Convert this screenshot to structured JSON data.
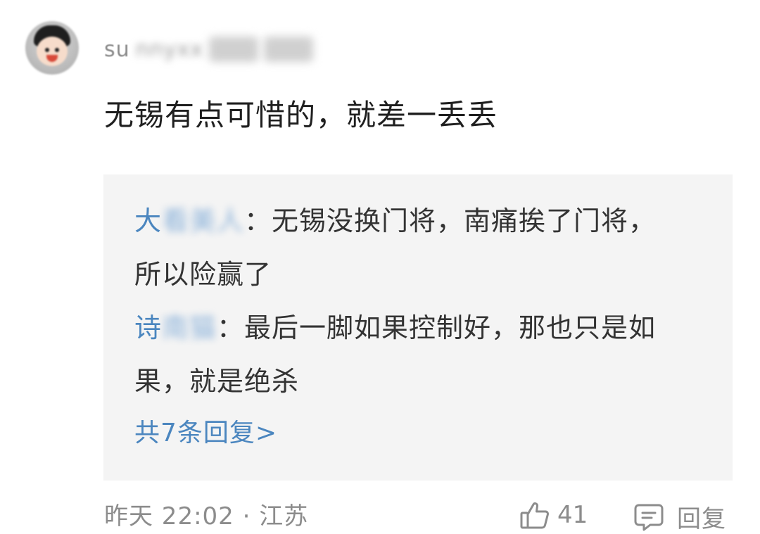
{
  "comment": {
    "username_visible": "su",
    "username_blurred": "nnyxx",
    "text": "无锡有点可惜的，就差一丢丢"
  },
  "replies": [
    {
      "author_visible": "大",
      "author_blurred": "看美人",
      "text": "：无锡没换门将，南痛挨了门将，所以险赢了"
    },
    {
      "author_visible": "诗",
      "author_blurred": "南猫",
      "text": "：最后一脚如果控制好，那也只是如果，就是绝杀"
    }
  ],
  "more_replies": "共7条回复>",
  "footer": {
    "meta": "昨天 22:02 · 江苏",
    "like_count": "41",
    "reply_label": "回复"
  },
  "colors": {
    "link_blue": "#4b86bf",
    "meta_gray": "#8c8c8c",
    "reply_bg": "#f4f4f4"
  },
  "icons": [
    "avatar",
    "thumbs-up-icon",
    "comment-bubble-icon"
  ]
}
